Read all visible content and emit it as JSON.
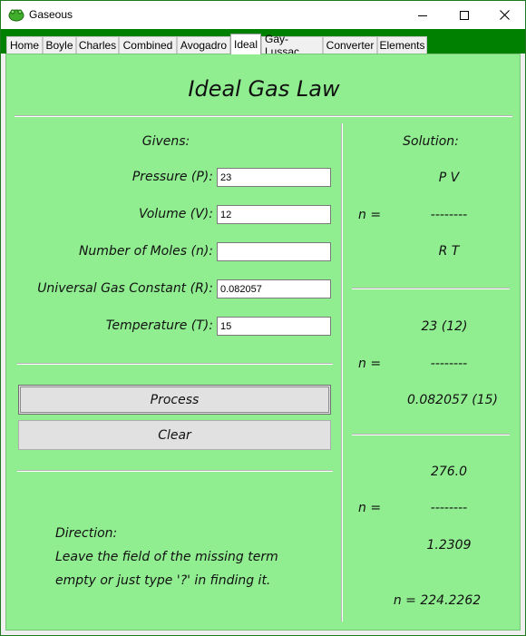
{
  "window": {
    "title": "Gaseous",
    "controls": {
      "minimize": "minimize",
      "maximize": "maximize",
      "close": "close"
    }
  },
  "tabs": [
    {
      "label": "Home"
    },
    {
      "label": "Boyle"
    },
    {
      "label": "Charles"
    },
    {
      "label": "Combined"
    },
    {
      "label": "Avogadro"
    },
    {
      "label": "Ideal",
      "active": true
    },
    {
      "label": "Gay-Lussac"
    },
    {
      "label": "Converter"
    },
    {
      "label": "Elements"
    }
  ],
  "panel": {
    "title": "Ideal Gas Law",
    "background": "#90ee90",
    "givens": {
      "heading": "Givens:",
      "pressure": {
        "label": "Pressure (P):",
        "value": "23"
      },
      "volume": {
        "label": "Volume (V):",
        "value": "12"
      },
      "moles": {
        "label": "Number of Moles (n):",
        "value": ""
      },
      "gas_constant": {
        "label": "Universal Gas Constant (R):",
        "value": "0.082057"
      },
      "temperature": {
        "label": "Temperature (T):",
        "value": "15"
      }
    },
    "buttons": {
      "process": "Process",
      "clear": "Clear"
    },
    "direction": {
      "heading": "Direction:",
      "line1": "Leave the field of the missing term",
      "line2": "empty or just type '?' in finding it."
    },
    "solution": {
      "heading": "Solution:",
      "formula": {
        "lhs": "n =",
        "numerator": "P V",
        "bar": "--------",
        "denominator": "R T"
      },
      "substituted": {
        "lhs": "n =",
        "numerator": "23 (12)",
        "bar": "--------",
        "denominator": "0.082057 (15)"
      },
      "evaluated": {
        "lhs": "n =",
        "numerator": "276.0",
        "bar": "--------",
        "denominator": "1.2309"
      },
      "result": "n = 224.2262"
    }
  }
}
